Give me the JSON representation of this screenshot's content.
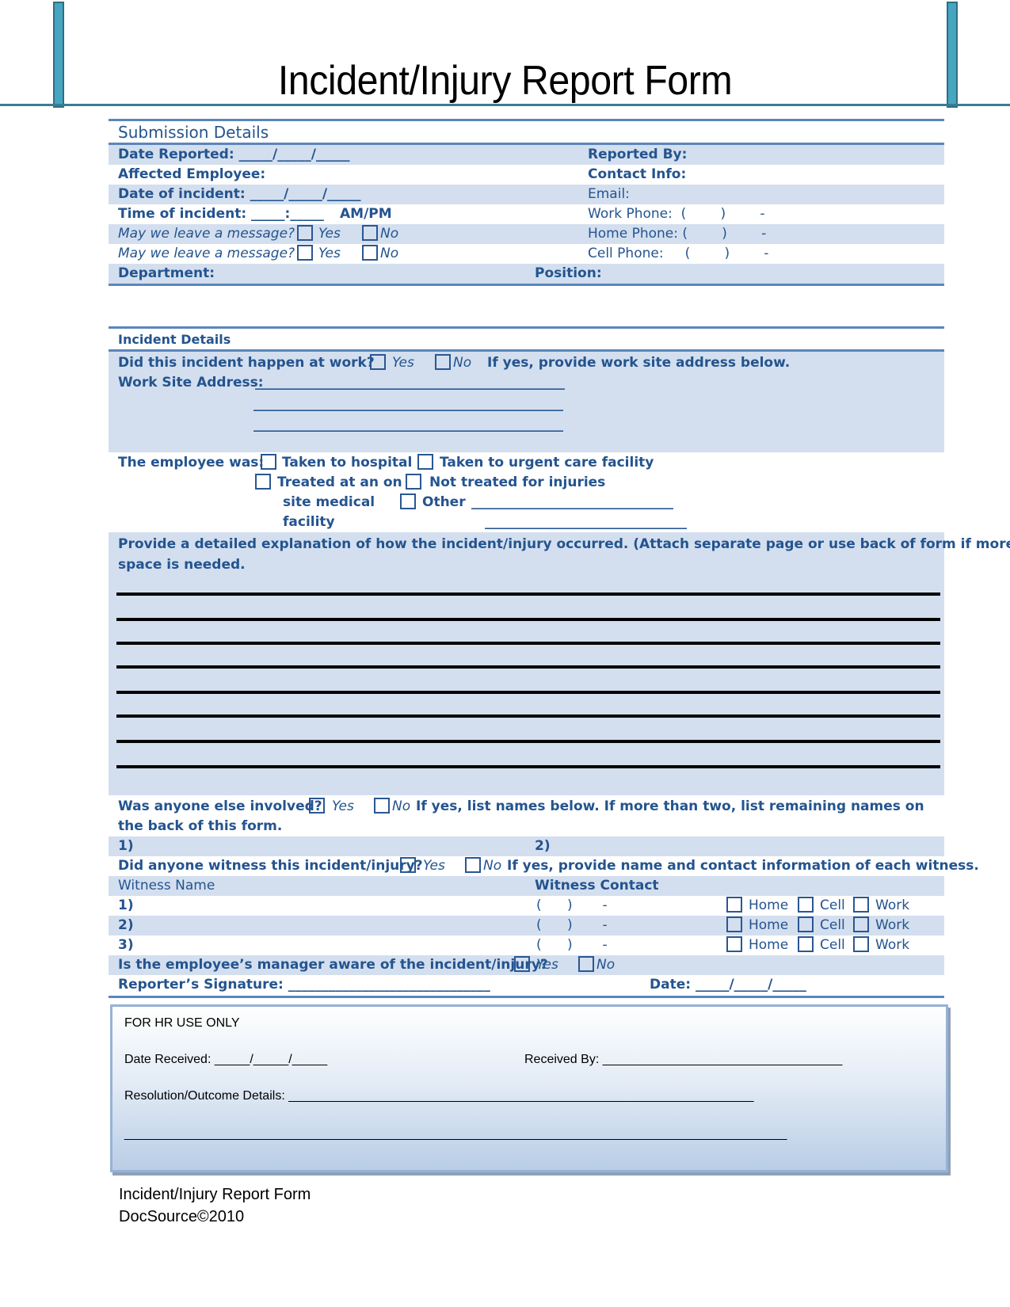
{
  "title": "Incident/Injury Report Form",
  "colors": {
    "accent": "#24548f",
    "band": "#d3dfef",
    "rule": "#5a86bd",
    "header_bar": "#46a6c2"
  },
  "submission": {
    "section_title": "Submission Details",
    "date_reported": "Date Reported: _____/_____/_____",
    "reported_by": "Reported By:",
    "affected_employee": "Affected Employee:",
    "contact_info": "Contact Info:",
    "date_of_incident": "Date of incident: _____/_____/_____",
    "email": "Email:",
    "time_of_incident": "Time of incident: _____:_____",
    "ampm": "AM/PM",
    "work_phone": "Work Phone:  (        )        -",
    "message_q": "May we leave a message?",
    "yes": "Yes",
    "no": "No",
    "home_phone": "Home Phone: (        )        -",
    "cell_phone": "Cell Phone:     (        )        -",
    "department": "Department:",
    "position": "Position:"
  },
  "incident": {
    "section_title": "Incident Details",
    "at_work_q": "Did this incident happen at work?",
    "yes": "Yes",
    "no": "No",
    "at_work_note": "If yes, provide work site address below.",
    "work_site_label": "Work Site Address:",
    "addr_line": "______________________________________________",
    "employee_was": "The employee was:",
    "opt_hospital": "Taken to hospital",
    "opt_urgent": "Taken to urgent care facility",
    "opt_onsite_1": "Treated at an on",
    "opt_onsite_2": "site medical",
    "opt_onsite_3": "facility",
    "opt_not_treated": "Not treated for injuries",
    "opt_other": "Other",
    "other_line": "______________________________",
    "other_line2": "______________________________",
    "explanation_1": "Provide a detailed explanation of how the incident/injury occurred. (Attach separate page or use back of form if more",
    "explanation_2": "space is needed.",
    "involved_q": "Was anyone else involved?",
    "involved_note": "If yes, list names below. If more than two, list remaining names on",
    "involved_note2": "the back of this form.",
    "involved_1": "1)",
    "involved_2": "2)",
    "witness_q": "Did anyone witness this incident/injury?",
    "witness_note": "If yes, provide name and contact information of each witness.",
    "witness_name_header": "Witness Name",
    "witness_contact_header": "Witness Contact",
    "witnesses": [
      {
        "num": "1)",
        "phone": "(      )       -",
        "home": "Home",
        "cell": "Cell",
        "work": "Work"
      },
      {
        "num": "2)",
        "phone": "(      )       -",
        "home": "Home",
        "cell": "Cell",
        "work": "Work"
      },
      {
        "num": "3)",
        "phone": "(      )       -",
        "home": "Home",
        "cell": "Cell",
        "work": "Work"
      }
    ],
    "manager_q": "Is the employee’s manager aware of the incident/injury?",
    "signature": "Reporter’s Signature: ______________________________",
    "sig_date": "Date: _____/_____/_____"
  },
  "hr": {
    "title": "FOR HR USE ONLY",
    "date_received": "Date Received: _____/_____/_____",
    "received_by": "Received By: __________________________________",
    "resolution": "Resolution/Outcome Details: __________________________________________________________________",
    "resolution_line": "______________________________________________________________________________________________"
  },
  "footer": {
    "line1": "Incident/Injury Report Form",
    "line2": "DocSource©2010"
  }
}
